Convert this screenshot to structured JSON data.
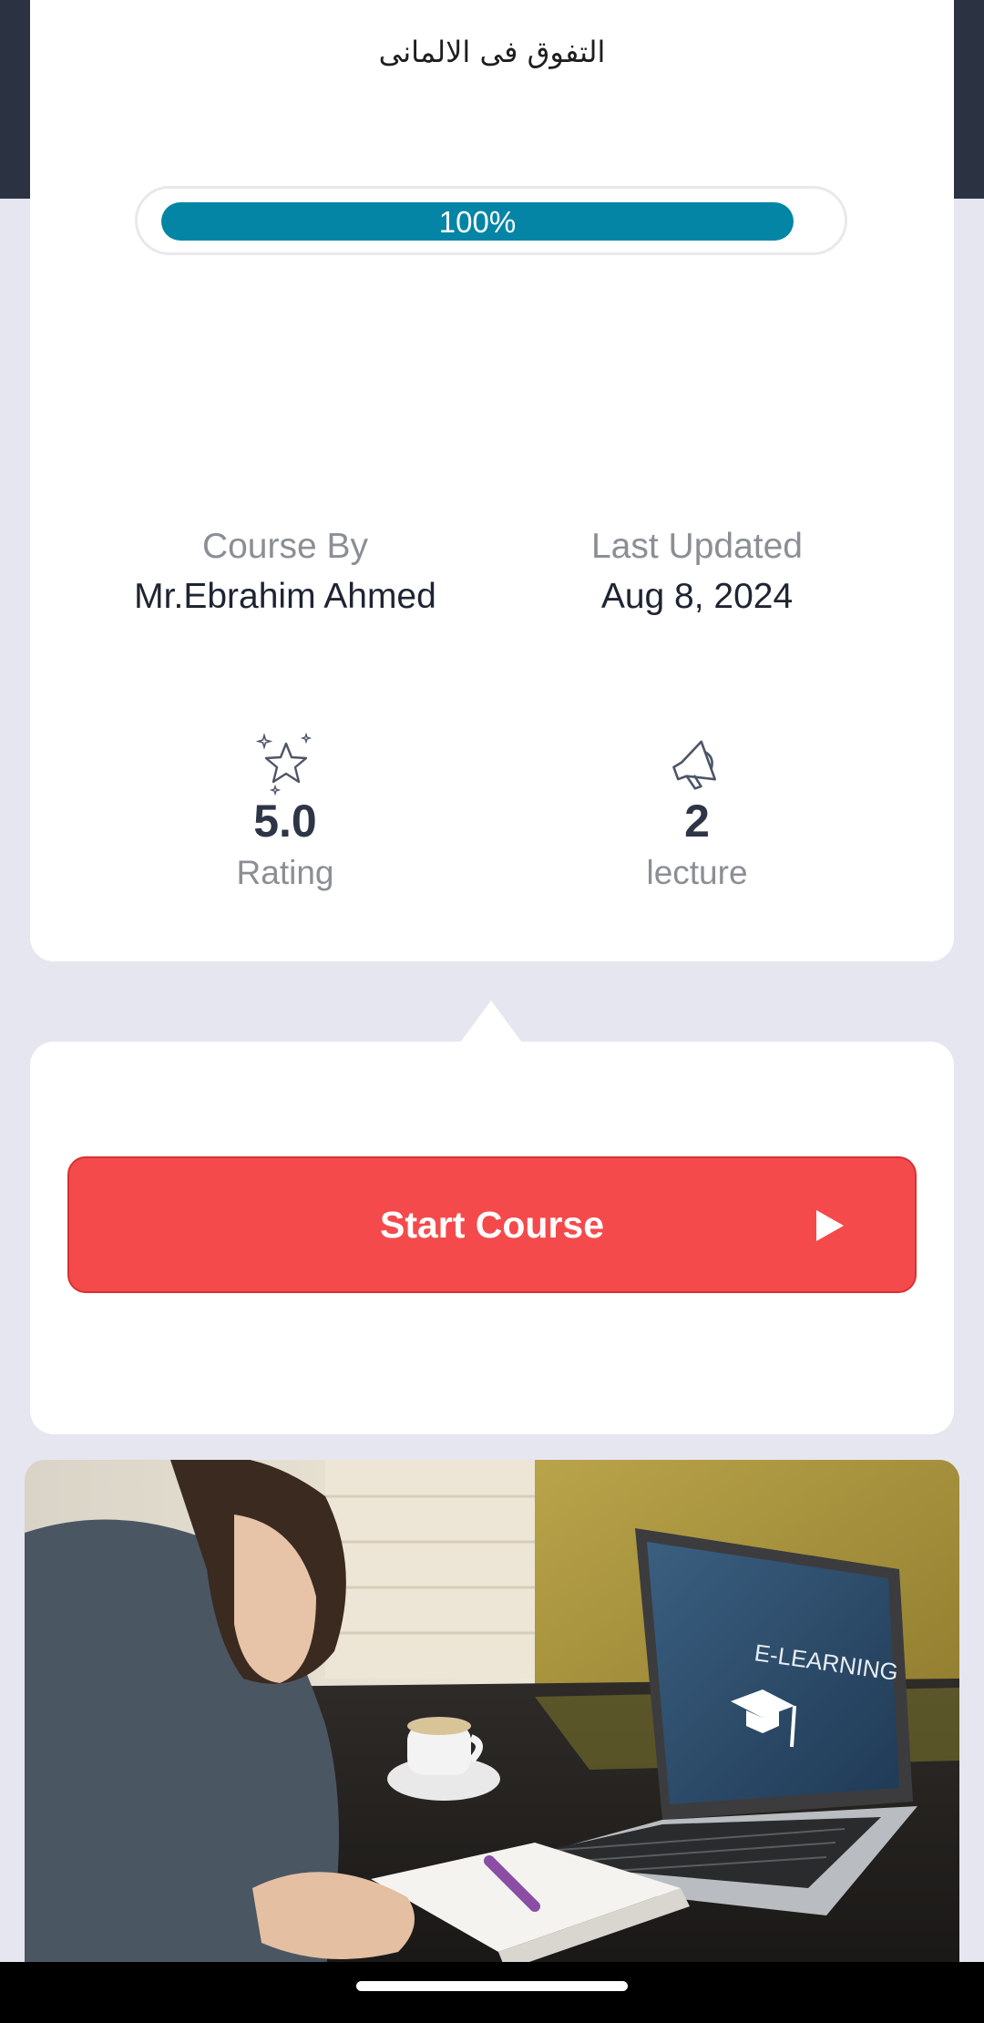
{
  "course": {
    "title": "التفوق فى الالمانى",
    "progress_value": 1.0,
    "progress_label": "100%"
  },
  "meta": {
    "course_by_label": "Course By",
    "course_by_value": "Mr.Ebrahim Ahmed",
    "last_updated_label": "Last Updated",
    "last_updated_value": "Aug 8, 2024"
  },
  "stats": {
    "rating_value": "5.0",
    "rating_label": "Rating",
    "rating_icon": "star-sparkle-icon",
    "lecture_value": "2",
    "lecture_label": "lecture",
    "lecture_icon": "megaphone-icon"
  },
  "action": {
    "start_label": "Start Course",
    "start_icon": "play-icon"
  },
  "hero": {
    "screen_text": "E-LEARNING"
  },
  "colors": {
    "accent_teal": "#0585a6",
    "start_red": "#f54a4c",
    "header_dark": "#2b3343",
    "page_bg": "#e6e6f0"
  }
}
